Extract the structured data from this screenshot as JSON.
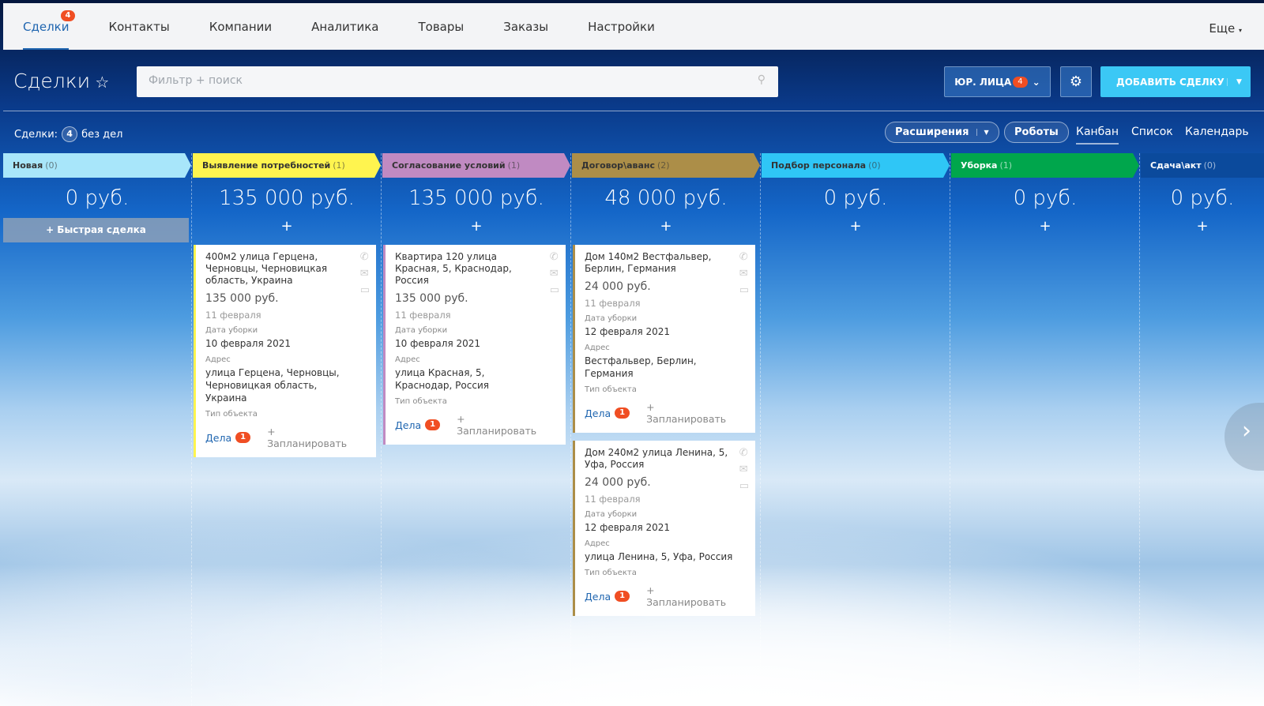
{
  "nav": {
    "tabs": [
      {
        "label": "Сделки",
        "badge": "4",
        "active": true
      },
      {
        "label": "Контакты"
      },
      {
        "label": "Компании"
      },
      {
        "label": "Аналитика"
      },
      {
        "label": "Товары"
      },
      {
        "label": "Заказы"
      },
      {
        "label": "Настройки"
      }
    ],
    "more": "Еще"
  },
  "header": {
    "title": "Сделки",
    "search_placeholder": "Фильтр + поиск",
    "legal_label": "ЮР. ЛИЦА",
    "legal_badge": "4",
    "add_label": "ДОБАВИТЬ СДЕЛКУ"
  },
  "toolbar": {
    "deals_label": "Сделки:",
    "deals_count": "4",
    "no_tasks": "без дел",
    "extensions": "Расширения",
    "robots": "Роботы",
    "views": [
      "Канбан",
      "Список",
      "Календарь"
    ]
  },
  "quick_deal": "Быстрая сделка",
  "labels": {
    "cleaning_date": "Дата уборки",
    "address": "Адрес",
    "object_type": "Тип объекта",
    "deals": "Дела",
    "plan": "+ Запланировать"
  },
  "columns": [
    {
      "name": "Новая",
      "count": "(0)",
      "sum": "0 руб.",
      "color": "#a8e6fa",
      "text": "#333",
      "cards": []
    },
    {
      "name": "Выявление потребностей",
      "count": "(1)",
      "sum": "135 000 руб.",
      "color": "#fff44f",
      "text": "#333",
      "cards": [
        {
          "title": "400м2 улица Герцена, Черновцы, Черновицкая область, Украина",
          "price": "135 000 руб.",
          "date": "11 февраля",
          "cleaning": "10 февраля 2021",
          "address": "улица Герцена, Черновцы, Черновицкая область, Украина",
          "tasks": "1"
        }
      ]
    },
    {
      "name": "Согласование условий",
      "count": "(1)",
      "sum": "135 000 руб.",
      "color": "#c08ac2",
      "text": "#333",
      "cards": [
        {
          "title": "Квартира 120 улица Красная, 5, Краснодар, Россия",
          "price": "135 000 руб.",
          "date": "11 февраля",
          "cleaning": "10 февраля 2021",
          "address": "улица Красная, 5, Краснодар, Россия",
          "tasks": "1"
        }
      ]
    },
    {
      "name": "Договор\\аванс",
      "count": "(2)",
      "sum": "48 000 руб.",
      "color": "#ac8e48",
      "text": "#333",
      "cards": [
        {
          "title": "Дом 140м2 Вестфальвер, Берлин, Германия",
          "price": "24 000 руб.",
          "date": "11 февраля",
          "cleaning": "12 февраля 2021",
          "address": "Вестфальвер, Берлин, Германия",
          "tasks": "1"
        },
        {
          "title": "Дом 240м2 улица Ленина, 5, Уфа, Россия",
          "price": "24 000 руб.",
          "date": "11 февраля",
          "cleaning": "12 февраля 2021",
          "address": "улица Ленина, 5, Уфа, Россия",
          "tasks": "1"
        }
      ]
    },
    {
      "name": "Подбор персонала",
      "count": "(0)",
      "sum": "0 руб.",
      "color": "#2fc6f6",
      "text": "#333",
      "cards": []
    },
    {
      "name": "Уборка",
      "count": "(1)",
      "sum": "0 руб.",
      "color": "#00a64c",
      "text": "#fff",
      "cards": []
    },
    {
      "name": "Сдача\\акт",
      "count": "(0)",
      "sum": "0 руб.",
      "color": "#0b4a9c",
      "text": "#fff",
      "cards": []
    }
  ]
}
